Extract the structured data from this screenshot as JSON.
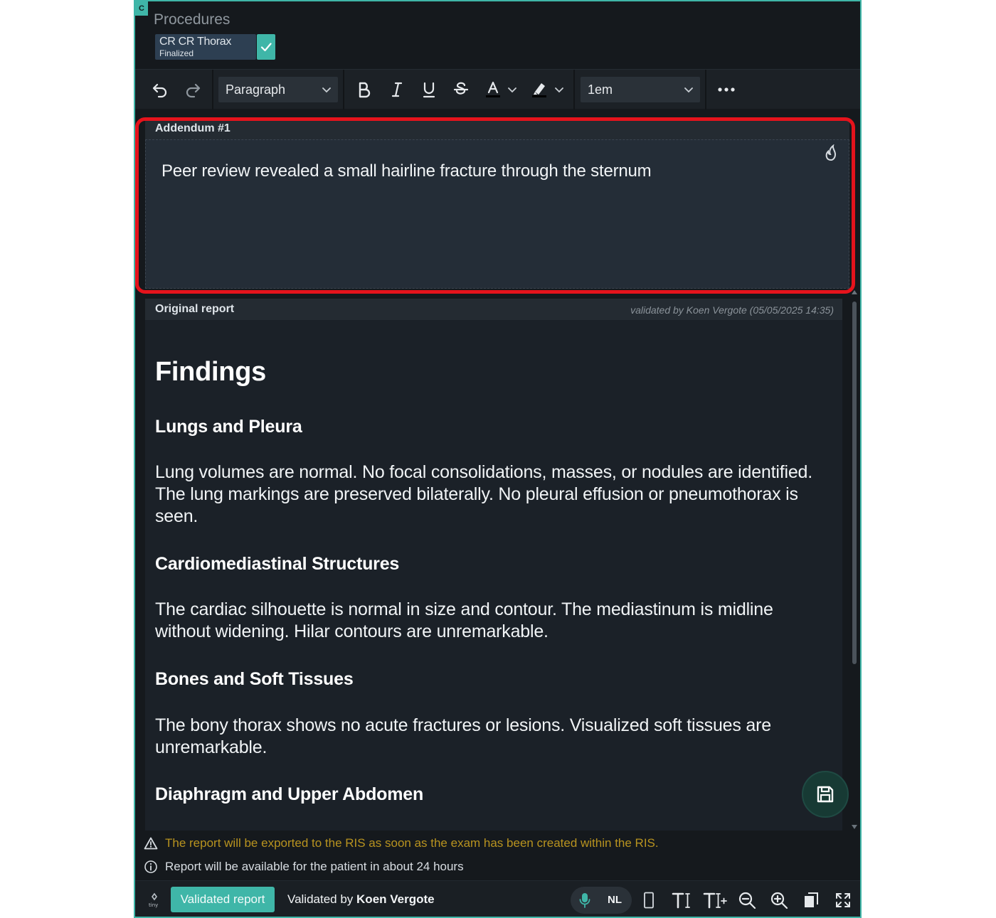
{
  "header": {
    "corner_badge": "C",
    "title": "Procedures",
    "procedure": {
      "name": "CR CR Thorax",
      "status": "Finalized"
    }
  },
  "toolbar": {
    "undo_icon": "undo-icon",
    "redo_icon": "redo-icon",
    "block_format": {
      "selected": "Paragraph"
    },
    "bold_icon": "bold-icon",
    "italic_icon": "italic-icon",
    "underline_icon": "underline-icon",
    "strikethrough_icon": "strikethrough-icon",
    "font_color_icon": "font-color-icon",
    "highlight_icon": "highlight-icon",
    "font_size": {
      "selected": "1em"
    },
    "more_icon": "more-icon"
  },
  "addendum": {
    "label": "Addendum #1",
    "text": "Peer review revealed a small hairline fracture through the sternum"
  },
  "original_report": {
    "label": "Original report",
    "validated": "validated by Koen Vergote (05/05/2025 14:35)",
    "heading": "Findings",
    "sections": [
      {
        "title": "Lungs and Pleura",
        "text": "Lung volumes are normal. No focal consolidations, masses, or nodules are identified. The lung markings are preserved bilaterally. No pleural effusion or pneumothorax is seen."
      },
      {
        "title": "Cardiomediastinal Structures",
        "text": "The cardiac silhouette is normal in size and contour. The mediastinum is midline without widening. Hilar contours are unremarkable."
      },
      {
        "title": "Bones and Soft Tissues",
        "text": "The bony thorax shows no acute fractures or lesions. Visualized soft tissues are unremarkable."
      },
      {
        "title": "Diaphragm and Upper Abdomen",
        "text": ""
      }
    ]
  },
  "notices": {
    "warning": "The report will be exported to the RIS as soon as the exam has been created within the RIS.",
    "info": "Report will be available for the patient in about 24 hours"
  },
  "bottombar": {
    "status_button": "Validated report",
    "validated_by_prefix": "Validated by",
    "validated_by_name": "Koen Vergote",
    "language": "NL"
  },
  "colors": {
    "accent": "#3fb6a8",
    "warning": "#b8931f",
    "highlight_border": "#e5131c",
    "background": "#15191d"
  }
}
